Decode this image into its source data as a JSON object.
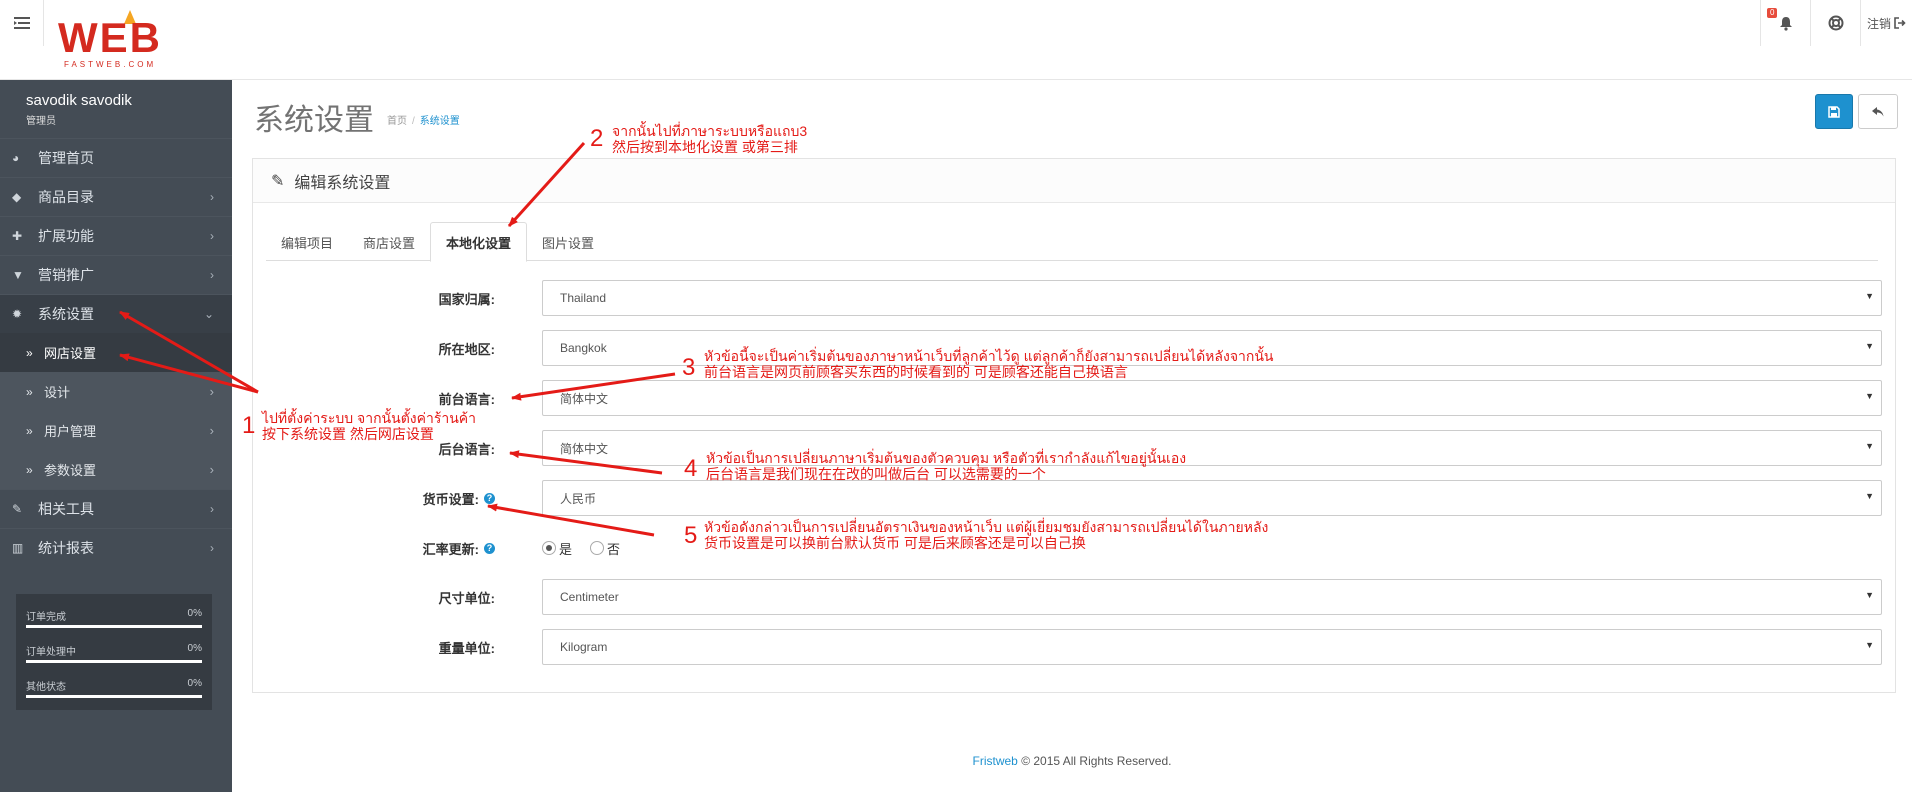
{
  "topbar": {
    "menu_icon": "hamburger-icon",
    "logo_text": "WEB",
    "logo_sub": "FASTWEB.COM",
    "notification_count": "0",
    "logout_label": "注销"
  },
  "sidebar": {
    "user_name": "savodik savodik",
    "user_role": "管理员",
    "items": [
      {
        "label": "管理首页",
        "icon": "dashboard-icon"
      },
      {
        "label": "商品目录",
        "icon": "tag-icon"
      },
      {
        "label": "扩展功能",
        "icon": "puzzle-icon"
      },
      {
        "label": "营销推广",
        "icon": "cart-icon"
      },
      {
        "label": "系统设置",
        "icon": "gear-icon"
      },
      {
        "label": "相关工具",
        "icon": "wrench-icon"
      },
      {
        "label": "统计报表",
        "icon": "bar-chart-icon"
      }
    ],
    "sub_items": [
      {
        "label": "网店设置"
      },
      {
        "label": "设计"
      },
      {
        "label": "用户管理"
      },
      {
        "label": "参数设置"
      }
    ],
    "stats": [
      {
        "label": "订单完成",
        "value": "0%"
      },
      {
        "label": "订单处理中",
        "value": "0%"
      },
      {
        "label": "其他状态",
        "value": "0%"
      }
    ]
  },
  "main": {
    "title": "系统设置",
    "breadcrumb": [
      "首页",
      "系统设置"
    ],
    "panel_title": "编辑系统设置",
    "tabs": [
      "编辑项目",
      "商店设置",
      "本地化设置",
      "图片设置"
    ],
    "active_tab": "本地化设置",
    "fields": [
      {
        "label": "国家归属:",
        "value": "Thailand"
      },
      {
        "label": "所在地区:",
        "value": "Bangkok"
      },
      {
        "label": "前台语言:",
        "value": "简体中文"
      },
      {
        "label": "后台语言:",
        "value": "简体中文"
      },
      {
        "label": "货币设置:",
        "value": "人民币"
      },
      {
        "label": "汇率更新:",
        "options": [
          "是",
          "否"
        ],
        "selected": "是"
      },
      {
        "label": "尺寸单位:",
        "value": "Centimeter"
      },
      {
        "label": "重量单位:",
        "value": "Kilogram"
      }
    ],
    "footer_link": "Fristweb",
    "footer_text": "© 2015 All Rights Reserved."
  },
  "annotations": {
    "color": "#e41b17",
    "notes": [
      {
        "num": "1",
        "lines": [
          "ไปที่ตั้งค่าระบบ จากนั้นตั้งค่าร้านค้า",
          "按下系统设置 然后网店设置"
        ]
      },
      {
        "num": "2",
        "lines": [
          "จากนั้นไปที่ภาษาระบบหรือแถบ3",
          "然后按到本地化设置 或第三排"
        ]
      },
      {
        "num": "3",
        "lines": [
          "หัวข้อนี้จะเป็นค่าเริ่มต้นของภาษาหน้าเว็บที่ลูกค้าไว้ดู แต่ลูกค้าก็ยังสามารถเปลี่ยนได้หลังจากนั้น",
          "前台语言是网页前顾客买东西的时候看到的 可是顾客还能自己换语言"
        ]
      },
      {
        "num": "4",
        "lines": [
          "หัวข้อเป็นการเปลี่ยนภาษาเริ่มต้นของตัวควบคุม หรือตัวที่เรากำลังแก้ไขอยู่นั้นเอง",
          "后台语言是我们现在在改的叫做后台 可以选需要的一个"
        ]
      },
      {
        "num": "5",
        "lines": [
          "หัวข้อดังกล่าวเป็นการเปลี่ยนอัตราเงินของหน้าเว็บ แต่ผู้เยี่ยมชมยังสามารถเปลี่ยนได้ในภายหลัง",
          "货币设置是可以换前台默认货币 可是后来顾客还是可以自己换"
        ]
      }
    ]
  }
}
